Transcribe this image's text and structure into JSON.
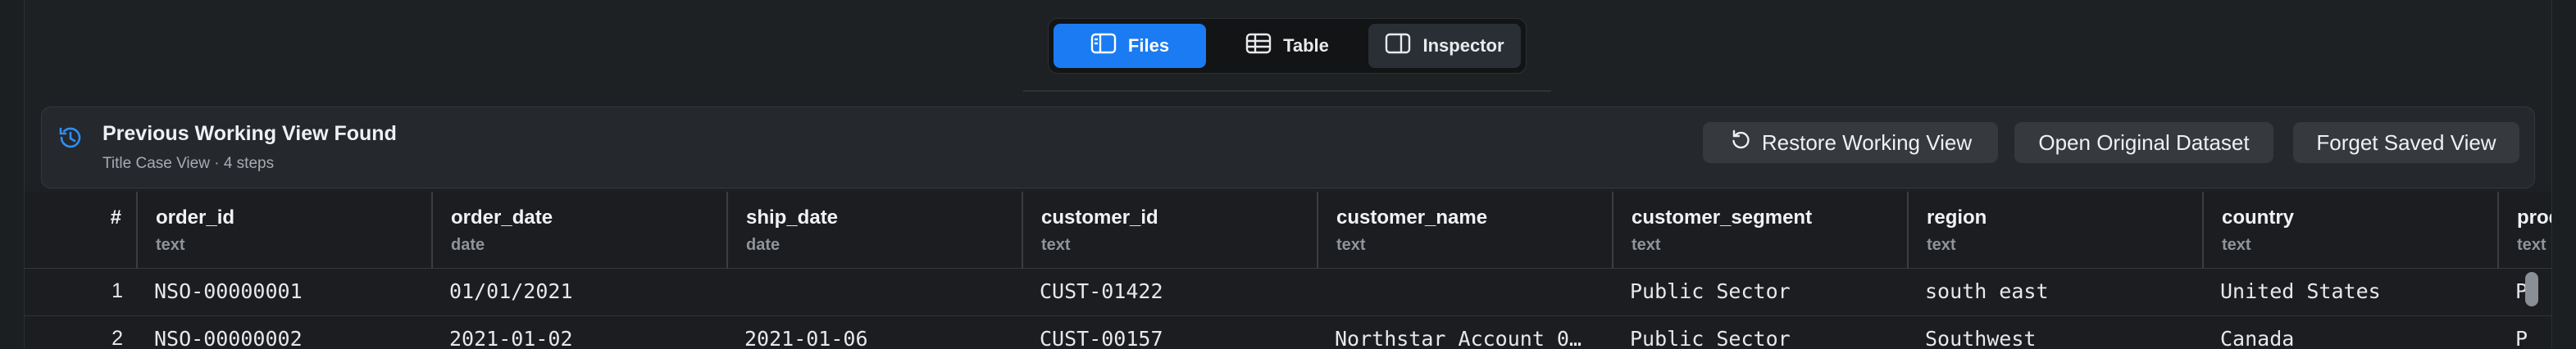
{
  "view_switcher": {
    "tabs": [
      {
        "label": "Files",
        "icon": "sidebar-panel-icon",
        "active": true
      },
      {
        "label": "Table",
        "icon": "table-grid-icon",
        "active": false
      },
      {
        "label": "Inspector",
        "icon": "inspector-panel-icon",
        "active": false
      }
    ]
  },
  "banner": {
    "icon": "history-icon",
    "title": "Previous Working View Found",
    "subtitle": "Title Case View · 4 steps",
    "buttons": {
      "restore": "Restore Working View",
      "open": "Open Original Dataset",
      "forget": "Forget Saved View"
    }
  },
  "table": {
    "index_header": "#",
    "columns": [
      {
        "name": "order_id",
        "type": "text"
      },
      {
        "name": "order_date",
        "type": "date"
      },
      {
        "name": "ship_date",
        "type": "date"
      },
      {
        "name": "customer_id",
        "type": "text"
      },
      {
        "name": "customer_name",
        "type": "text"
      },
      {
        "name": "customer_segment",
        "type": "text"
      },
      {
        "name": "region",
        "type": "text"
      },
      {
        "name": "country",
        "type": "text"
      },
      {
        "name": "prod",
        "type": "text"
      }
    ],
    "rows": [
      {
        "index": "1",
        "cells": [
          "NSO-00000001",
          "01/01/2021",
          "",
          "CUST-01422",
          "",
          "Public Sector",
          "south east",
          "United States",
          "P"
        ]
      },
      {
        "index": "2",
        "cells": [
          "NSO-00000002",
          "2021-01-02",
          "2021-01-06",
          "CUST-00157",
          "Northstar Account 0…",
          "Public Sector",
          "Southwest",
          "Canada",
          "P"
        ]
      }
    ]
  },
  "colors": {
    "accent": "#1a7bf2",
    "background": "#1e2124",
    "banner": "#25282c",
    "button": "#36393e"
  }
}
